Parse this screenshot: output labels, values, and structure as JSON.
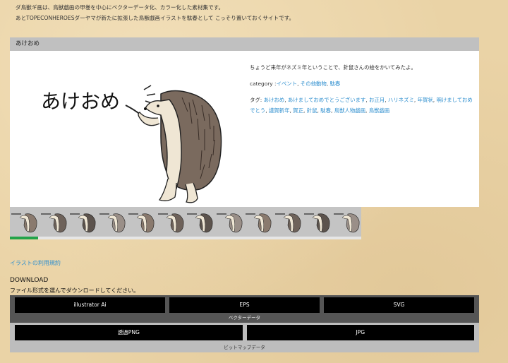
{
  "intro": {
    "line1": "ダ鳥獣ギ画は、鳥獣戯画の甲巻を中心にベクターデータ化、カラー化した素材集です。",
    "line2": "あとTOPECONHEROESダーヤマが新たに拡張した鳥獣戯画イラストを駄春として こっそり置いておくサイトです。"
  },
  "post": {
    "title": "あけおめ",
    "art_text": "あけおめ",
    "description": "ちょうど来年がネズミ年ということで、針鼠さんの絵をかいてみたよ。",
    "category_label": "category :",
    "categories": [
      "イベント",
      "その他動物",
      "駄春"
    ],
    "tags_label": "タグ: ",
    "tags": [
      "あけおめ",
      "あけましておめでとうございます",
      "お正月",
      "ハリネズミ",
      "年賀状",
      "明けましておめでとう",
      "謹賀新年",
      "賀正",
      "針鼠",
      "駄春",
      "鳥獣人物戯画",
      "鳥獣戯画"
    ]
  },
  "gallery": {
    "thumb_count": 12,
    "progress_fraction": 0.08
  },
  "colors": {
    "link": "#2f8fcf",
    "progress": "#22a34a",
    "header_bg": "#c0c0c0"
  },
  "terms_link": "イラストの利用規約",
  "download": {
    "title": "DOWNLOAD",
    "subtitle": "ファイル形式を選んでダウンロードしてください。",
    "vector_buttons": [
      "illustrator Ai",
      "EPS",
      "SVG"
    ],
    "vector_caption": "ベクターデータ",
    "bitmap_buttons": [
      "透過PNG",
      "JPG"
    ],
    "bitmap_caption": "ビットマップデータ"
  }
}
